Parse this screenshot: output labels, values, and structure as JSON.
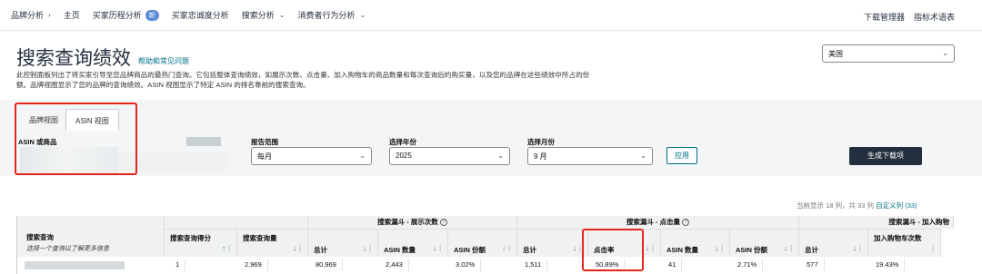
{
  "nav": {
    "items": [
      {
        "label": "品牌分析",
        "chevron": true
      },
      {
        "label": "主页",
        "chevron": false
      },
      {
        "label": "买家历程分析",
        "badge": "新",
        "chevron": false
      },
      {
        "label": "买家忠诚度分析",
        "chevron": false
      },
      {
        "label": "搜索分析",
        "chevron": true
      },
      {
        "label": "消费者行为分析",
        "chevron": true
      }
    ],
    "right": [
      "下载管理器",
      "指标术语表"
    ]
  },
  "page": {
    "title": "搜索查询绩效",
    "help_link": "帮助和常见问题",
    "description": "此控制面板列出了将买家引导至您品牌商品的最热门查询。它包括整体查询绩效，如展示次数、点击量、加入购物车的商品数量和每次查询后的购买量，以及您的品牌在这些绩效中所占的份额。品牌视图显示了您的品牌的查询绩效。ASIN 视图显示了特定 ASIN 的排名靠前的搜索查询。",
    "region": "美国"
  },
  "tabs": [
    "品牌视图",
    "ASIN 视图"
  ],
  "filters": {
    "asin_label": "ASIN 或商品",
    "period_label": "报告范围",
    "period_value": "每月",
    "year_label": "选择年份",
    "year_value": "2025",
    "month_label": "选择月份",
    "month_value": "9 月",
    "apply": "应用",
    "generate": "生成下载项"
  },
  "table_meta": {
    "count_text": "当前显示 18 列，共 33 列",
    "custom_cols": "自定义列 (33)"
  },
  "table": {
    "groups": [
      "搜索漏斗 - 展示次数",
      "搜索漏斗 - 点击量",
      "搜索漏斗 - 加入购物"
    ],
    "first_header": "搜索查询",
    "first_sub": "选择一个查询以了解更多信息",
    "headers": [
      "搜索查询得分",
      "搜索查询量",
      "总计",
      "ASIN 数量",
      "ASIN 份额",
      "总计",
      "点击率",
      "ASIN 数量",
      "ASIN 份额",
      "总计",
      "加入购物车次数"
    ],
    "row": [
      "1",
      "2,969",
      "80,969",
      "2,443",
      "3.02%",
      "1,511",
      "50.89%",
      "41",
      "2.71%",
      "577",
      "19.43%"
    ]
  }
}
